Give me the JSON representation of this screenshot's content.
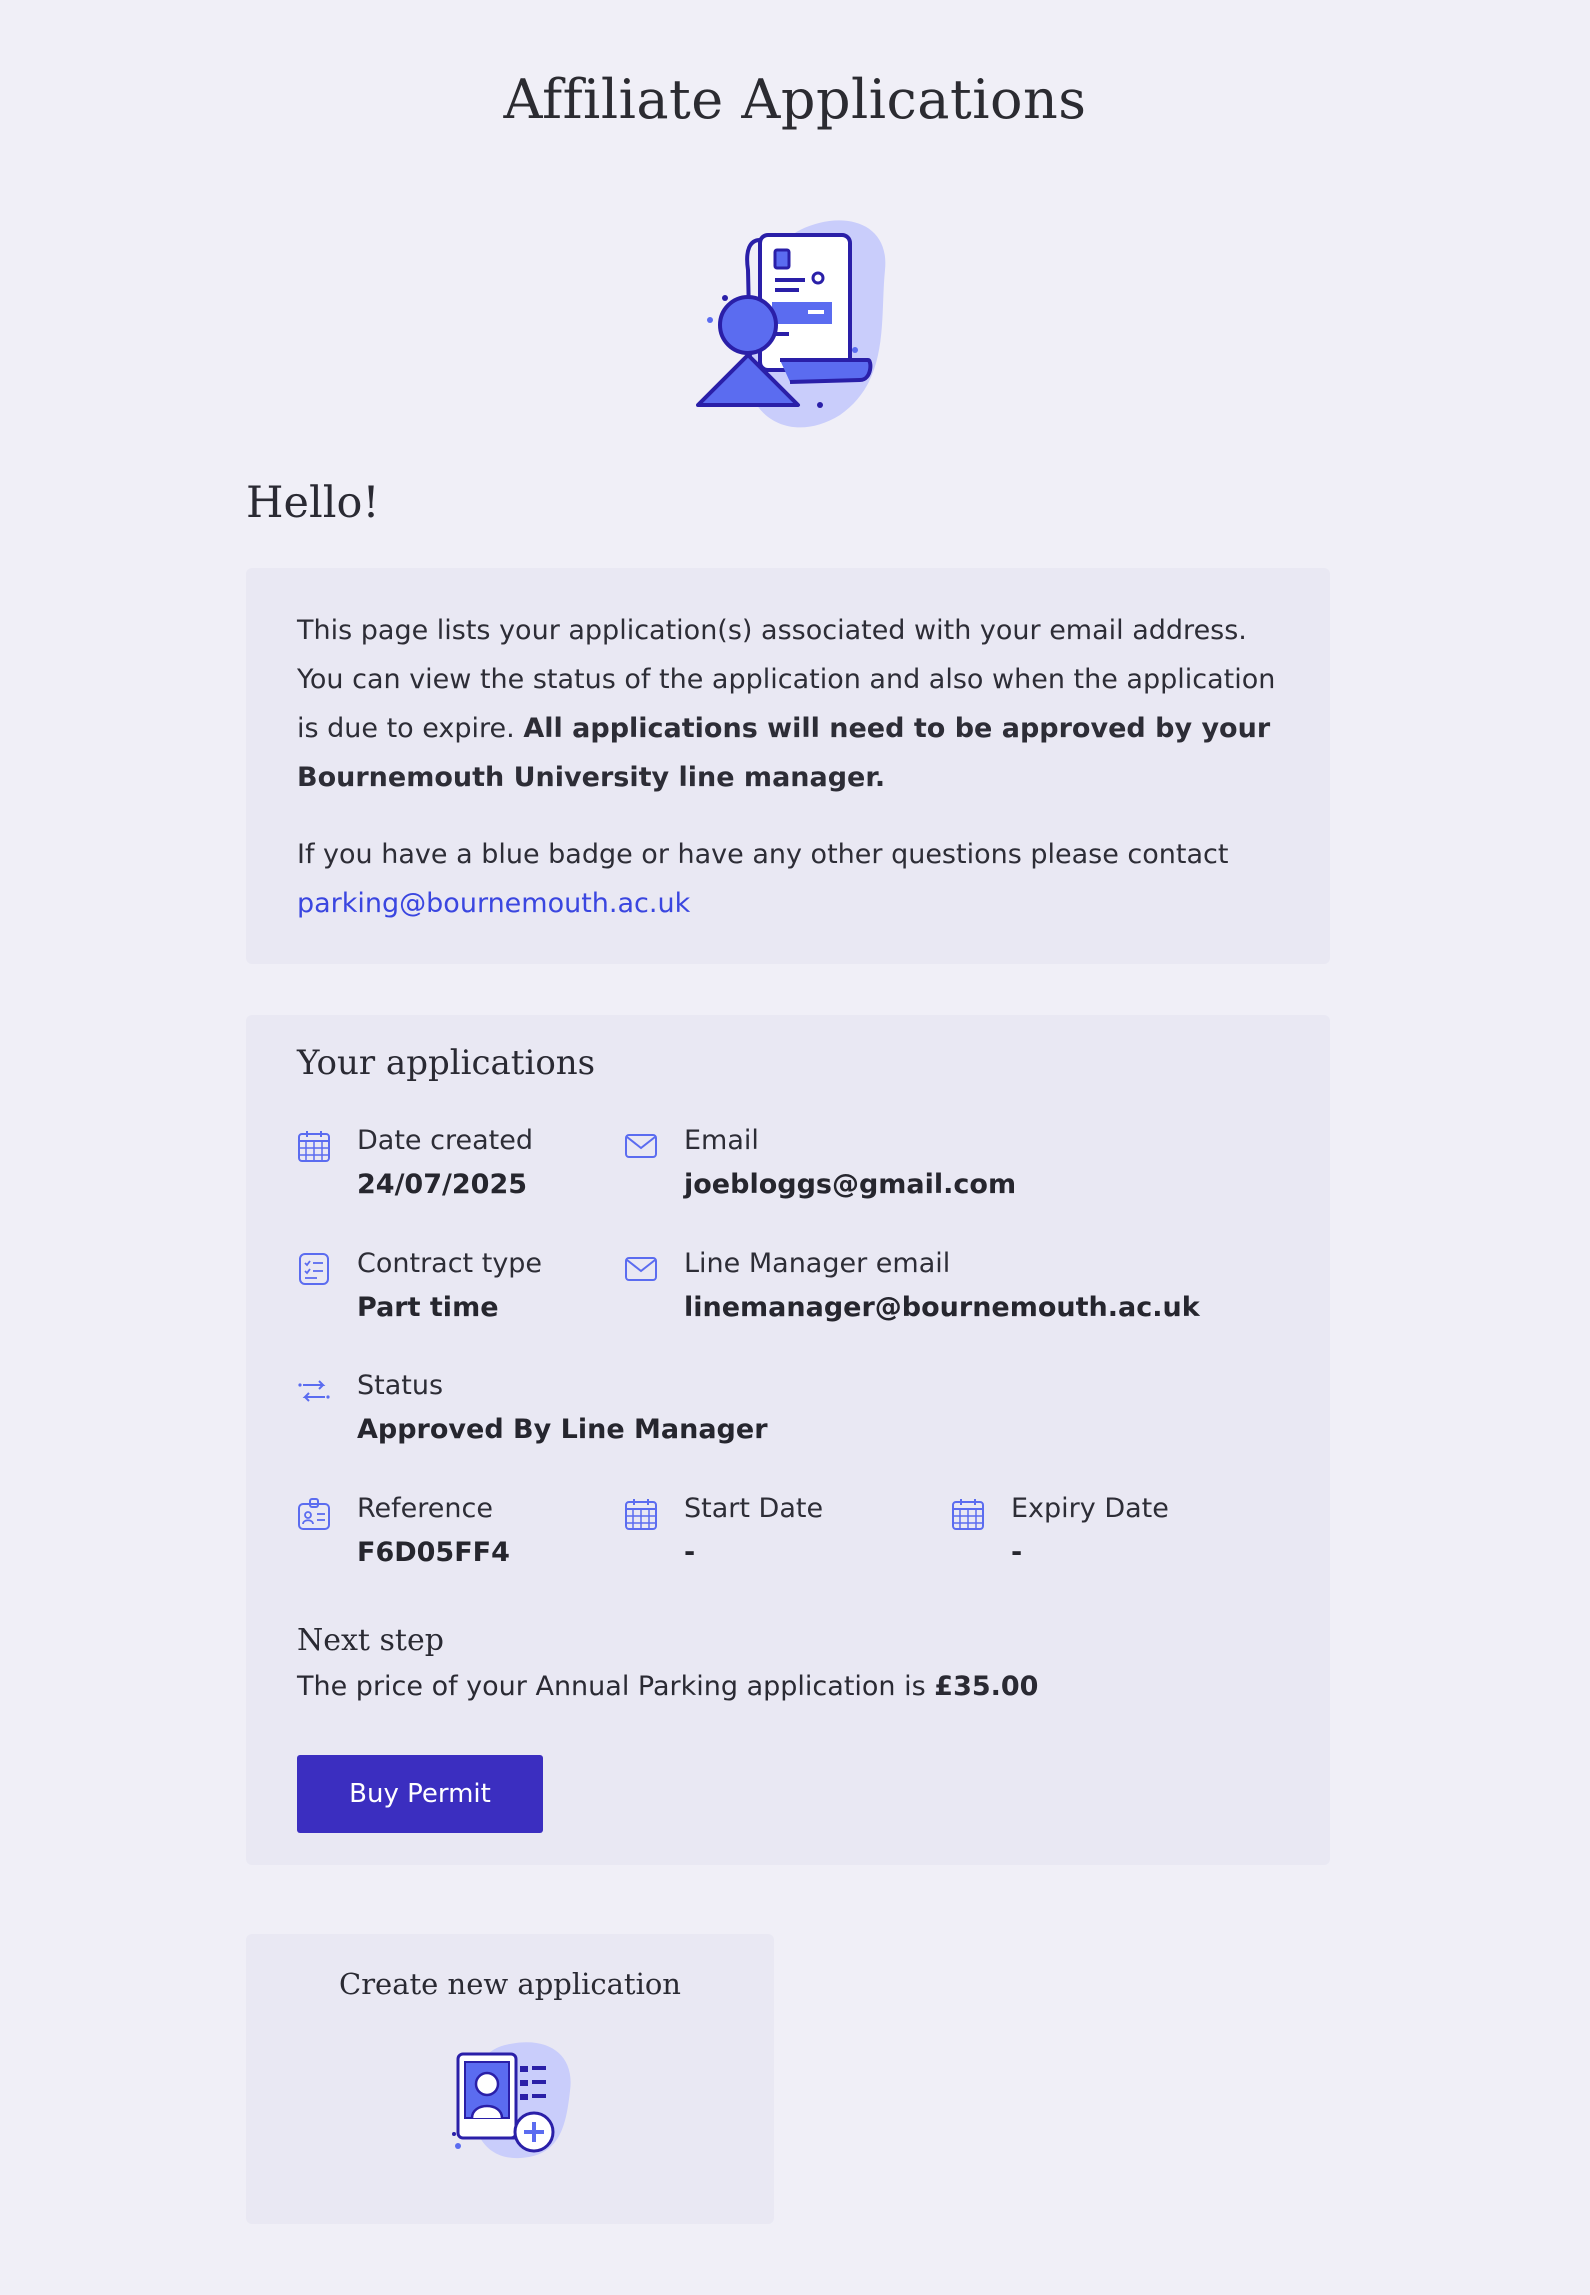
{
  "page": {
    "title": "Affiliate Applications"
  },
  "greeting": "Hello!",
  "intro": {
    "text_prefix": "This page lists your application(s) associated with your email address. You can view the status of the application and also when the application is due to expire.",
    "text_bold": "All applications will need to be approved by your Bournemouth University line manager.",
    "contact_prefix": "If you have a blue badge or have any other questions please contact",
    "contact_email": "parking@bournemouth.ac.uk"
  },
  "applications": {
    "heading": "Your applications",
    "fields": {
      "date_created": {
        "label": "Date created",
        "value": "24/07/2025",
        "icon": "calendar-icon"
      },
      "email": {
        "label": "Email",
        "value": "joebloggs@gmail.com",
        "icon": "envelope-icon"
      },
      "contract_type": {
        "label": "Contract type",
        "value": "Part time",
        "icon": "checklist-icon"
      },
      "line_manager_email": {
        "label": "Line Manager email",
        "value": "linemanager@bournemouth.ac.uk",
        "icon": "envelope-icon"
      },
      "status": {
        "label": "Status",
        "value": "Approved By Line Manager",
        "icon": "transfer-arrows-icon"
      },
      "reference": {
        "label": "Reference",
        "value": "F6D05FF4",
        "icon": "id-card-icon"
      },
      "start_date": {
        "label": "Start Date",
        "value": "-",
        "icon": "calendar-icon"
      },
      "expiry_date": {
        "label": "Expiry Date",
        "value": "-",
        "icon": "calendar-icon"
      }
    },
    "next_step": {
      "title": "Next step",
      "price_prefix": "The price of your Annual Parking application is",
      "price": "£35.00"
    },
    "buy_button": "Buy Permit"
  },
  "new_application": {
    "title": "Create new application",
    "icon": "add-profile-icon"
  },
  "colors": {
    "background": "#f0eff7",
    "panel": "#e9e8f3",
    "accent": "#3b2ec0",
    "link": "#3a46e0",
    "icon": "#5b6cf0"
  }
}
